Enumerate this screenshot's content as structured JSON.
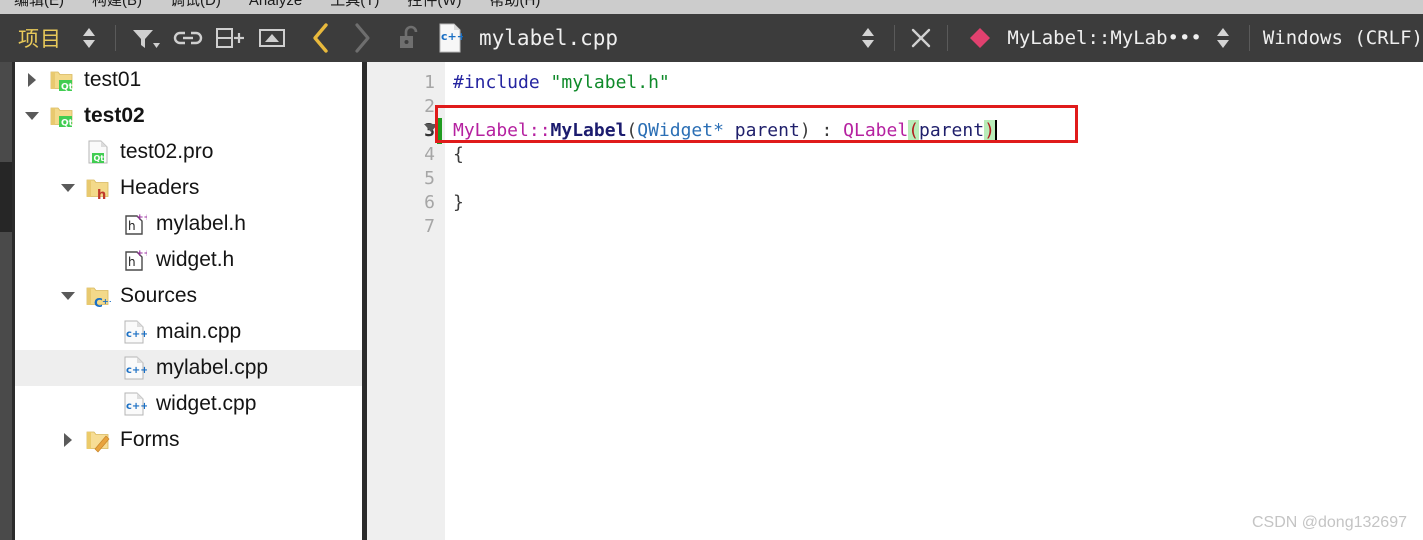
{
  "menubar": {
    "items": [
      {
        "label": "编辑(E)"
      },
      {
        "label": "构建(B)"
      },
      {
        "label": "调试(D)"
      },
      {
        "label": "Analyze"
      },
      {
        "label": "工具(T)"
      },
      {
        "label": "控件(W)"
      },
      {
        "label": "帮助(H)"
      }
    ]
  },
  "toolbar": {
    "project_label": "项目",
    "stepper_icon": "up-down-stepper-icon",
    "filter_icon": "filter-funnel-icon",
    "link_icon": "link-chain-icon",
    "split_icon": "split-editor-icon",
    "collapse_icon": "collapse-panel-icon",
    "back_icon": "navigate-back-icon",
    "forward_icon": "navigate-forward-icon",
    "lock_icon": "unlocked-padlock-icon",
    "filetype_icon": "cpp-file-icon",
    "file_name": "mylabel.cpp",
    "file_stepper_icon": "file-stepper-icon",
    "close_icon": "close-document-icon",
    "symbol_icon": "symbol-diamond-icon",
    "symbol_name": "MyLabel::MyLab•••",
    "symbol_stepper_icon": "symbol-stepper-icon",
    "eol_label": "Windows  (CRLF)"
  },
  "sidebar": {
    "tree": [
      {
        "indent": 0,
        "twisty": "collapsed",
        "icon": "qt-project-folder-icon",
        "label": "test01",
        "bold": false,
        "selected": false
      },
      {
        "indent": 0,
        "twisty": "expanded",
        "icon": "qt-project-folder-icon",
        "label": "test02",
        "bold": true,
        "selected": false
      },
      {
        "indent": 1,
        "twisty": "none",
        "icon": "qt-pro-file-icon",
        "label": "test02.pro",
        "bold": false,
        "selected": false
      },
      {
        "indent": 1,
        "twisty": "expanded",
        "icon": "headers-folder-icon",
        "label": "Headers",
        "bold": false,
        "selected": false
      },
      {
        "indent": 2,
        "twisty": "none",
        "icon": "h-plusplus-file-icon",
        "label": "mylabel.h",
        "bold": false,
        "selected": false
      },
      {
        "indent": 2,
        "twisty": "none",
        "icon": "h-plusplus-file-icon",
        "label": "widget.h",
        "bold": false,
        "selected": false
      },
      {
        "indent": 1,
        "twisty": "expanded",
        "icon": "sources-folder-icon",
        "label": "Sources",
        "bold": false,
        "selected": false
      },
      {
        "indent": 2,
        "twisty": "none",
        "icon": "cpp-file-icon",
        "label": "main.cpp",
        "bold": false,
        "selected": false
      },
      {
        "indent": 2,
        "twisty": "none",
        "icon": "cpp-file-icon",
        "label": "mylabel.cpp",
        "bold": false,
        "selected": true
      },
      {
        "indent": 2,
        "twisty": "none",
        "icon": "cpp-file-icon",
        "label": "widget.cpp",
        "bold": false,
        "selected": false
      },
      {
        "indent": 1,
        "twisty": "collapsed",
        "icon": "forms-folder-icon",
        "label": "Forms",
        "bold": false,
        "selected": false
      }
    ]
  },
  "editor": {
    "line_numbers": [
      "1",
      "2",
      "3",
      "4",
      "5",
      "6",
      "7"
    ],
    "current_line": "3",
    "lines": {
      "l1_include": "#include ",
      "l1_header": "\"mylabel.h\"",
      "l3_scope": "MyLabel::",
      "l3_ctor": "MyLabel",
      "l3_open": "(",
      "l3_type": "QWidget*",
      "l3_param": " parent",
      "l3_close": ")",
      "l3_colon": " : ",
      "l3_base": "QLabel",
      "l3_bracket_open": "(",
      "l3_base_arg": "parent",
      "l3_bracket_close": ")",
      "l4_brace": "{",
      "l6_brace": "}"
    }
  },
  "annotation": {
    "highlight_name": "red-highlight-box"
  },
  "watermark": {
    "text": "CSDN @dong132697"
  },
  "colors": {
    "toolbar_bg": "#3c3c3c",
    "menubar_bg": "#cccccc",
    "accent_yellow": "#e8c95a",
    "annotation_red": "#e01b1b",
    "selection_gray": "#eeeeee",
    "gutter_bg": "#efefef",
    "change_green": "#1f9b1f",
    "bracket_match_green": "#b9edb9"
  }
}
